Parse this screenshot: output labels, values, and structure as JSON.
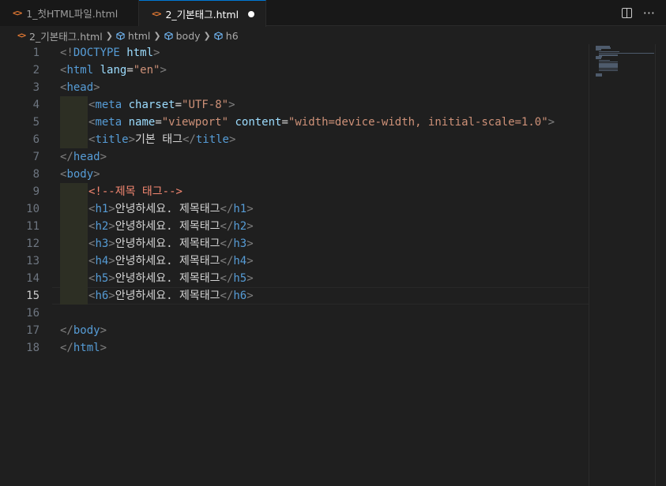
{
  "tabs": [
    {
      "label": "1_첫HTML파일.html",
      "icon": "html-file-icon",
      "active": false
    },
    {
      "label": "2_기본태그.html",
      "icon": "html-file-icon",
      "active": true,
      "dirty": true
    }
  ],
  "tab_actions": {
    "split": "split-editor-icon",
    "more": "···"
  },
  "breadcrumb": {
    "file": "2_기본태그.html",
    "items": [
      "html",
      "body",
      "h6"
    ]
  },
  "editor": {
    "current_line": 15,
    "line_numbers": [
      "1",
      "2",
      "3",
      "4",
      "5",
      "6",
      "7",
      "8",
      "9",
      "10",
      "11",
      "12",
      "13",
      "14",
      "15",
      "16",
      "17",
      "18"
    ],
    "lines": [
      [
        [
          "br",
          "<!"
        ],
        [
          "tag",
          "DOCTYPE "
        ],
        [
          "attr",
          "html"
        ],
        [
          "br",
          ">"
        ]
      ],
      [
        [
          "br",
          "<"
        ],
        [
          "tag",
          "html "
        ],
        [
          "attr",
          "lang"
        ],
        [
          "txt",
          "="
        ],
        [
          "str",
          "\"en\""
        ],
        [
          "br",
          ">"
        ]
      ],
      [
        [
          "br",
          "<"
        ],
        [
          "tag",
          "head"
        ],
        [
          "br",
          ">"
        ]
      ],
      [
        [
          "br",
          "<"
        ],
        [
          "tag",
          "meta "
        ],
        [
          "attr",
          "charset"
        ],
        [
          "txt",
          "="
        ],
        [
          "str",
          "\"UTF-8\""
        ],
        [
          "br",
          ">"
        ]
      ],
      [
        [
          "br",
          "<"
        ],
        [
          "tag",
          "meta "
        ],
        [
          "attr",
          "name"
        ],
        [
          "txt",
          "="
        ],
        [
          "str",
          "\"viewport\" "
        ],
        [
          "attr",
          "content"
        ],
        [
          "txt",
          "="
        ],
        [
          "str",
          "\"width=device-width, initial-scale=1.0\""
        ],
        [
          "br",
          ">"
        ]
      ],
      [
        [
          "br",
          "<"
        ],
        [
          "tag",
          "title"
        ],
        [
          "br",
          ">"
        ],
        [
          "txt",
          "기본 태그"
        ],
        [
          "br",
          "</"
        ],
        [
          "tag",
          "title"
        ],
        [
          "br",
          ">"
        ]
      ],
      [
        [
          "br",
          "</"
        ],
        [
          "tag",
          "head"
        ],
        [
          "br",
          ">"
        ]
      ],
      [
        [
          "br",
          "<"
        ],
        [
          "tag",
          "body"
        ],
        [
          "br",
          ">"
        ]
      ],
      [
        [
          "cm",
          "<!--제목 태그-->"
        ]
      ],
      [
        [
          "br",
          "<"
        ],
        [
          "tag",
          "h1"
        ],
        [
          "br",
          ">"
        ],
        [
          "txt",
          "안녕하세요. 제목태그"
        ],
        [
          "br",
          "</"
        ],
        [
          "tag",
          "h1"
        ],
        [
          "br",
          ">"
        ]
      ],
      [
        [
          "br",
          "<"
        ],
        [
          "tag",
          "h2"
        ],
        [
          "br",
          ">"
        ],
        [
          "txt",
          "안녕하세요. 제목태그"
        ],
        [
          "br",
          "</"
        ],
        [
          "tag",
          "h2"
        ],
        [
          "br",
          ">"
        ]
      ],
      [
        [
          "br",
          "<"
        ],
        [
          "tag",
          "h3"
        ],
        [
          "br",
          ">"
        ],
        [
          "txt",
          "안녕하세요. 제목태그"
        ],
        [
          "br",
          "</"
        ],
        [
          "tag",
          "h3"
        ],
        [
          "br",
          ">"
        ]
      ],
      [
        [
          "br",
          "<"
        ],
        [
          "tag",
          "h4"
        ],
        [
          "br",
          ">"
        ],
        [
          "txt",
          "안녕하세요. 제목태그"
        ],
        [
          "br",
          "</"
        ],
        [
          "tag",
          "h4"
        ],
        [
          "br",
          ">"
        ]
      ],
      [
        [
          "br",
          "<"
        ],
        [
          "tag",
          "h5"
        ],
        [
          "br",
          ">"
        ],
        [
          "txt",
          "안녕하세요. 제목태그"
        ],
        [
          "br",
          "</"
        ],
        [
          "tag",
          "h5"
        ],
        [
          "br",
          ">"
        ]
      ],
      [
        [
          "br",
          "<"
        ],
        [
          "tag",
          "h6"
        ],
        [
          "br",
          ">"
        ],
        [
          "txt",
          "안녕하세요. 제목태그"
        ],
        [
          "br",
          "</"
        ],
        [
          "tag",
          "h6"
        ],
        [
          "br",
          ">"
        ]
      ],
      [],
      [
        [
          "br",
          "</"
        ],
        [
          "tag",
          "body"
        ],
        [
          "br",
          ">"
        ]
      ],
      [
        [
          "br",
          "</"
        ],
        [
          "tag",
          "html"
        ],
        [
          "br",
          ">"
        ]
      ]
    ],
    "indent_levels": [
      0,
      0,
      0,
      1,
      1,
      1,
      0,
      0,
      1,
      1,
      1,
      1,
      1,
      1,
      1,
      0,
      0,
      0
    ]
  },
  "colors": {
    "accent": "#0078d4",
    "tag": "#569cd6",
    "attr": "#9cdcfe",
    "string": "#ce9178",
    "bracket": "#808080",
    "comment": "#f48771",
    "file_icon": "#e37933"
  }
}
